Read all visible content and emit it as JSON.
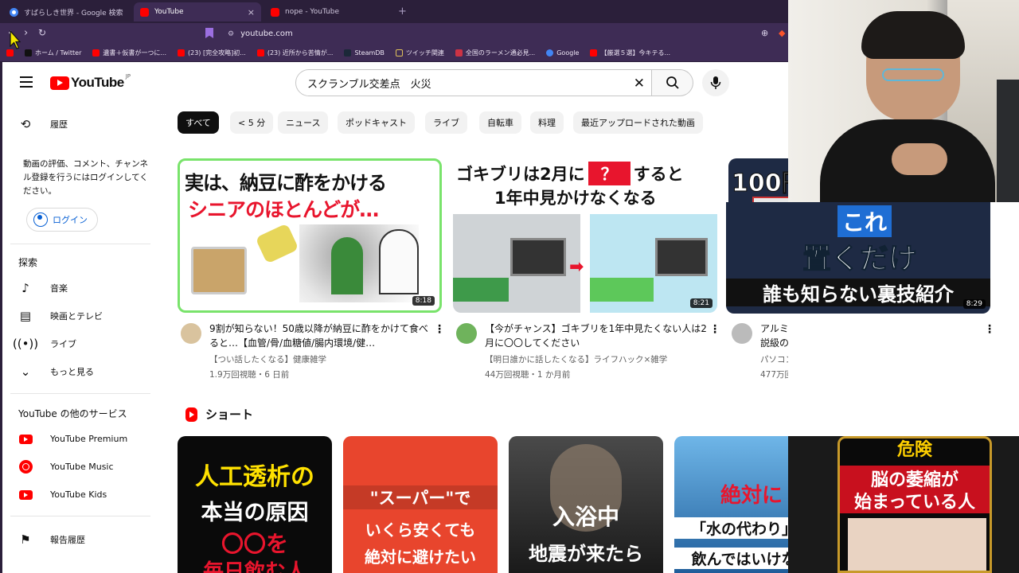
{
  "browser": {
    "tabs": [
      {
        "title": "すばらしき世界 - Google 検索",
        "color": "#4285f4"
      },
      {
        "title": "YouTube",
        "color": "#ff0000",
        "active": true
      },
      {
        "title": "nope - YouTube",
        "color": "#ff0000"
      }
    ],
    "tab_close_glyph": "×",
    "new_tab_glyph": "+",
    "url": "youtube.com",
    "bookmarks": [
      {
        "label": "ホーム / Twitter",
        "color": "#111111"
      },
      {
        "label": "遺書＋仮書が一つに...",
        "color": "#ff0000"
      },
      {
        "label": "(23) [完全攻略]初...",
        "color": "#ff0000"
      },
      {
        "label": "(23) 近所から苦情が...",
        "color": "#ff0000"
      },
      {
        "label": "SteamDB",
        "color": "#1b2838"
      },
      {
        "label": "ツイッチ関連",
        "color": "#e0c15a"
      },
      {
        "label": "全国のラーメン通必見...",
        "color": "#cc3344"
      },
      {
        "label": "Google",
        "color": "#4285f4"
      },
      {
        "label": "【厳選５選】今キテる...",
        "color": "#ff0000"
      }
    ]
  },
  "youtube": {
    "logo_text": "YouTube",
    "logo_region": "JP",
    "search_value": "スクランブル交差点　火災",
    "sidebar": {
      "history": "履歴",
      "note": "動画の評価、コメント、チャンネル登録を行うにはログインしてください。",
      "login": "ログイン",
      "explore_title": "探索",
      "explore": [
        {
          "label": "音楽",
          "icon": "music-note-icon"
        },
        {
          "label": "映画とテレビ",
          "icon": "film-icon"
        },
        {
          "label": "ライブ",
          "icon": "live-icon"
        },
        {
          "label": "もっと見る",
          "icon": "chevron-down-icon"
        }
      ],
      "more_title": "YouTube の他のサービス",
      "services": [
        {
          "label": "YouTube Premium"
        },
        {
          "label": "YouTube Music"
        },
        {
          "label": "YouTube Kids"
        }
      ],
      "report": "報告履歴"
    },
    "chips": [
      "すべて",
      "< 5 分",
      "ニュース",
      "ポッドキャスト",
      "ライブ",
      "自転車",
      "料理",
      "最近アップロードされた動画"
    ],
    "videos": [
      {
        "title": "9割が知らない！50歳以降が納豆に酢をかけて食べると…【血管/骨/血糖値/腸内環境/健…",
        "channel": "【つい話したくなる】健康雑学",
        "meta": "1.9万回視聴・6 日前",
        "duration": "8:18",
        "thumb_line1": "実は、納豆に酢をかける",
        "thumb_line2": "シニアのほとんどが…"
      },
      {
        "title": "【今がチャンス】ゴキブリを1年中見たくない人は2月に〇〇してください",
        "channel": "【明日誰かに話したくなる】ライフハック×雑学",
        "meta": "44万回視聴・1 か月前",
        "duration": "8:21",
        "thumb_line1": "ゴキブリは2月に",
        "thumb_q": "？",
        "thumb_line1b": "すると",
        "thumb_line2": "1年中見かけなくなる"
      },
      {
        "title": "アルミホイルを置くだけでWi-Fiが強くなる？都市伝説級の裏ワザをガチ検証！【驚きの…",
        "channel": "パソコン博士TAIKI",
        "meta": "477万回視聴・1 年前",
        "duration": "8:29",
        "thumb_line0": "100円",
        "thumb_line1": "これ",
        "thumb_line2": "置くだけ",
        "thumb_line3": "誰も知らない裏技紹介"
      }
    ],
    "shorts_title": "ショート",
    "shorts": [
      {
        "line1": "人工透析の",
        "line2": "本当の原因",
        "line3": "〇〇を",
        "line4": "毎日飲む人"
      },
      {
        "line1": "\"スーパー\"で",
        "line2": "いくら安くても",
        "line3": "絶対に避けたい"
      },
      {
        "line1": "入浴中",
        "line2": "地震が来たら"
      },
      {
        "line1": "絶対に",
        "line2": "「水の代わり」に",
        "line3": "飲んではいけない"
      },
      {
        "line1": "危険",
        "line2": "脳の萎縮が",
        "line3": "始まっている人"
      }
    ]
  },
  "colors": {
    "accent": "#ff0000",
    "link": "#065fd4",
    "browser_chrome": "#3e2c55"
  }
}
